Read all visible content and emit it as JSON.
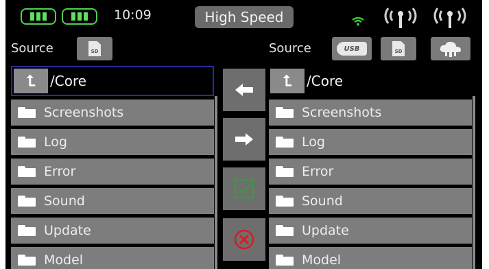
{
  "status": {
    "time": "10:09",
    "mode": "High Speed",
    "icons": [
      "battery-icon",
      "battery-icon",
      "wifi-icon",
      "antenna-icon",
      "antenna-icon"
    ],
    "battery_color": "#5fe05f"
  },
  "left": {
    "source_label": "Source",
    "source_icon": "sd-card-icon",
    "sd_text": "SD",
    "path": "/Core",
    "items": [
      "Screenshots",
      "Log",
      "Error",
      "Sound",
      "Update",
      "Model"
    ]
  },
  "right": {
    "source_label": "Source",
    "sources": [
      "USB",
      "SD",
      "cloud"
    ],
    "usb_text": "USB",
    "sd_text": "SD",
    "path": "/Core",
    "items": [
      "Screenshots",
      "Log",
      "Error",
      "Sound",
      "Update",
      "Model"
    ]
  },
  "actions": [
    "copy-left",
    "copy-right",
    "confirm",
    "cancel"
  ],
  "colors": {
    "background": "#000000",
    "row": "#7d7d7d",
    "confirm": "#3a9a3a",
    "cancel": "#d02020"
  }
}
